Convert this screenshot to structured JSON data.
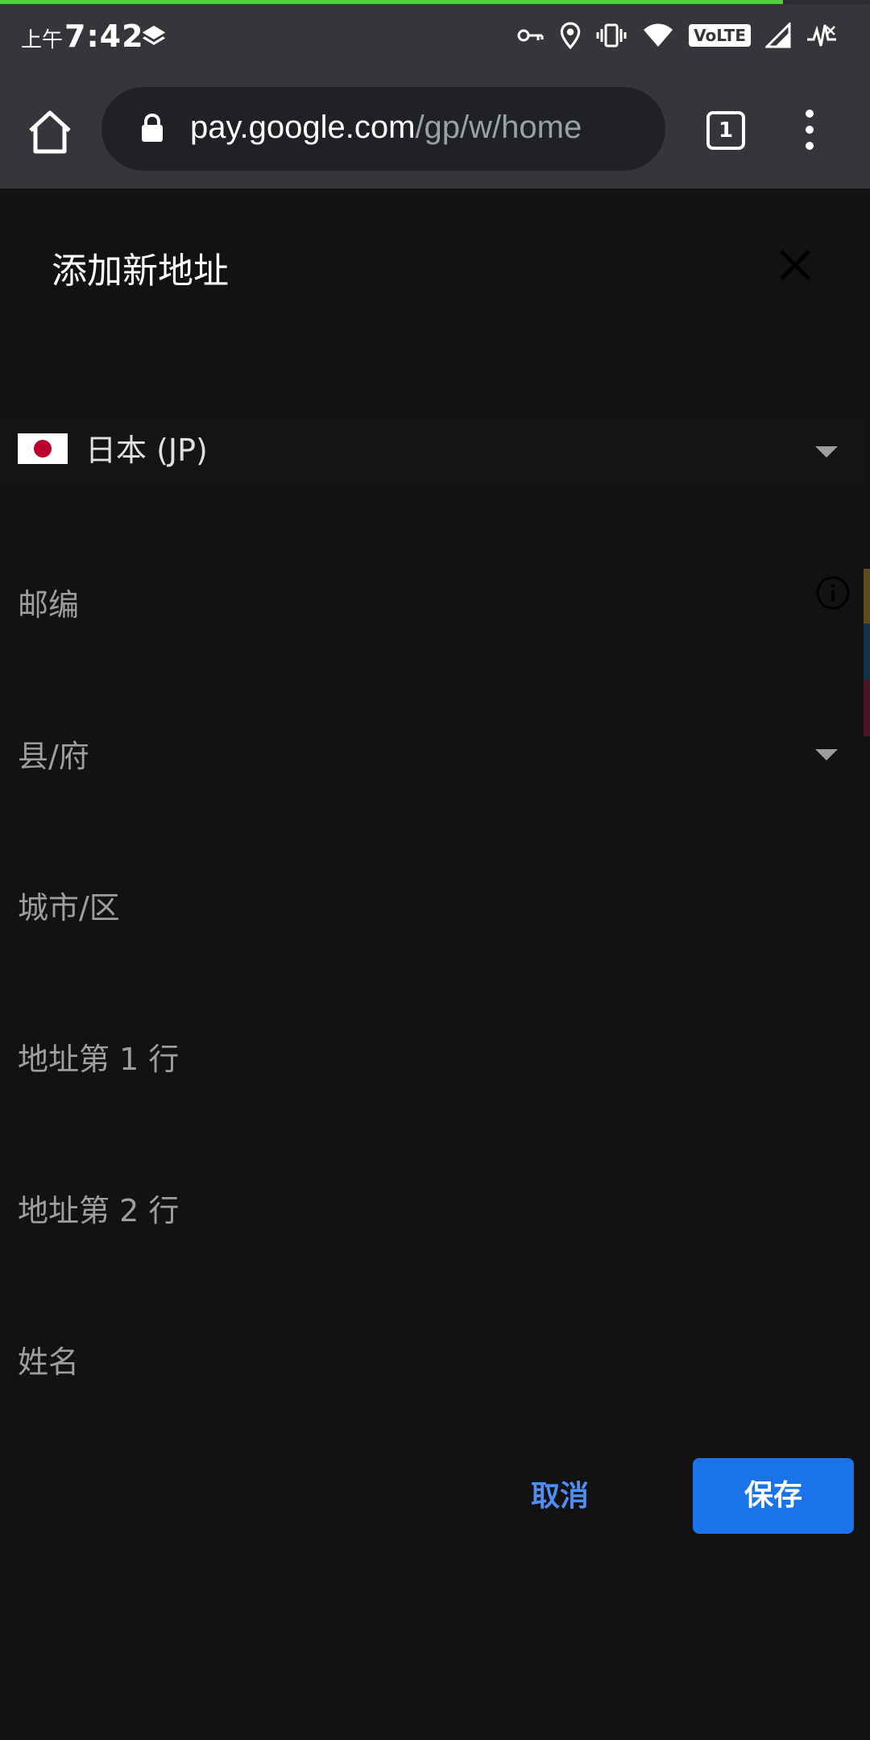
{
  "page_load_progress": 0.9,
  "status_bar": {
    "time_prefix": "上午",
    "time": "7:42",
    "network_badge": "VoLTE",
    "icons": [
      "layers-icon",
      "key-icon",
      "location-icon",
      "vibrate-icon",
      "wifi-icon",
      "volte-icon",
      "signal-icon",
      "no-signal-icon"
    ]
  },
  "browser": {
    "url_host": "pay.google.com",
    "url_path": "/gp/w/home",
    "tab_count": "1"
  },
  "dialog": {
    "title": "添加新地址",
    "country": {
      "value": "日本 (JP)",
      "flag": "japan-flag"
    },
    "fields": {
      "postal_code": "邮编",
      "prefecture": "县/府",
      "city": "城市/区",
      "address_line1": "地址第 1 行",
      "address_line2": "地址第 2 行",
      "name": "姓名"
    },
    "cancel_label": "取消",
    "save_label": "保存"
  },
  "colors": {
    "accent": "#1a73e8",
    "link": "#4d8ff7",
    "background": "#121212",
    "toolbar": "#35363a",
    "progress": "#4fd03a"
  }
}
